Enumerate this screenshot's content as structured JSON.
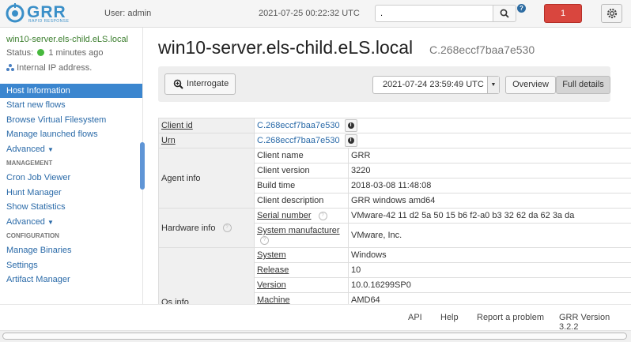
{
  "topbar": {
    "logo_text": "GRR",
    "logo_subtext": "RAPID RESPONSE",
    "user": "User: admin",
    "clock": "2021-07-25 00:22:32 UTC",
    "search_value": ".",
    "help_badge": "?",
    "notifications_count": "1"
  },
  "sidebar": {
    "client_hostname": "win10-server.els-child.eLS.local",
    "status_label": "Status:",
    "status_time": "1 minutes ago",
    "ip_note": "Internal IP address.",
    "nav": [
      {
        "label": "Host Information",
        "active": true
      },
      {
        "label": "Start new flows"
      },
      {
        "label": "Browse Virtual Filesystem"
      },
      {
        "label": "Manage launched flows"
      },
      {
        "label": "Advanced"
      }
    ],
    "management_header": "MANAGEMENT",
    "management": [
      {
        "label": "Cron Job Viewer"
      },
      {
        "label": "Hunt Manager"
      },
      {
        "label": "Show Statistics"
      },
      {
        "label": "Advanced"
      }
    ],
    "configuration_header": "CONFIGURATION",
    "configuration": [
      {
        "label": "Manage Binaries"
      },
      {
        "label": "Settings"
      },
      {
        "label": "Artifact Manager"
      }
    ]
  },
  "main": {
    "title": "win10-server.els-child.eLS.local",
    "client_urn": "C.268eccf7baa7e530",
    "interrogate_label": "Interrogate",
    "date_selected": "2021-07-24 23:59:49 UTC",
    "overview_label": "Overview",
    "full_details_label": "Full details",
    "details": {
      "client_id_label": "Client id",
      "client_id_value": "C.268eccf7baa7e530",
      "urn_label": "Urn",
      "urn_value": "C.268eccf7baa7e530",
      "agent_info_label": "Agent info",
      "agent_info": [
        {
          "key": "Client name",
          "value": "GRR"
        },
        {
          "key": "Client version",
          "value": "3220"
        },
        {
          "key": "Build time",
          "value": "2018-03-08 11:48:08"
        },
        {
          "key": "Client description",
          "value": "GRR windows amd64"
        }
      ],
      "hardware_info_label": "Hardware info",
      "hardware_info": [
        {
          "key": "Serial number",
          "value": "VMware-42 11 d2 5a 50 15 b6 f2-a0 b3 32 62 da 62 3a da"
        },
        {
          "key": "System manufacturer",
          "value": "VMware, Inc."
        }
      ],
      "os_info_label": "Os info",
      "os_info": [
        {
          "key": "System",
          "value": "Windows"
        },
        {
          "key": "Release",
          "value": "10"
        },
        {
          "key": "Version",
          "value": "10.0.16299SP0"
        },
        {
          "key": "Machine",
          "value": "AMD64"
        }
      ]
    }
  },
  "footer": {
    "api": "API",
    "help": "Help",
    "report": "Report a problem",
    "version": "GRR Version 3.2.2"
  }
}
